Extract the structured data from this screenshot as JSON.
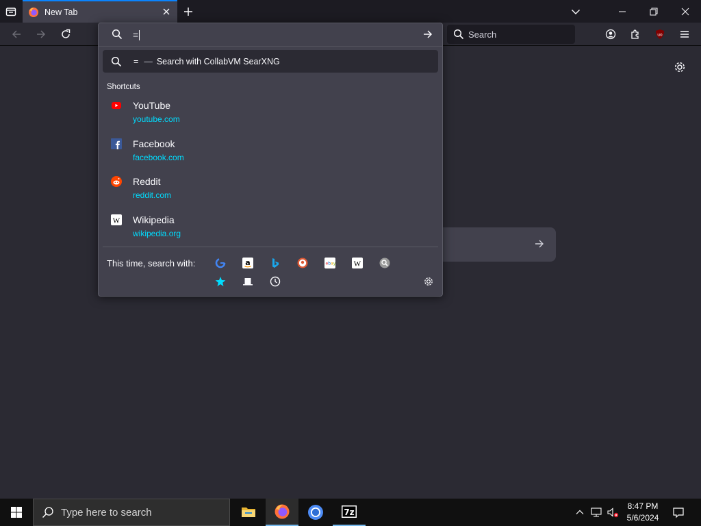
{
  "browser": {
    "tab": {
      "title": "New Tab"
    },
    "search_box": {
      "placeholder": "Search"
    },
    "urlbar": {
      "value": "=",
      "heuristic": {
        "query": "=",
        "separator": "—",
        "action": "Search with CollabVM SearXNG"
      },
      "shortcuts_title": "Shortcuts",
      "shortcuts": [
        {
          "title": "YouTube",
          "url": "youtube.com",
          "icon": "youtube-icon"
        },
        {
          "title": "Facebook",
          "url": "facebook.com",
          "icon": "facebook-icon"
        },
        {
          "title": "Reddit",
          "url": "reddit.com",
          "icon": "reddit-icon"
        },
        {
          "title": "Wikipedia",
          "url": "wikipedia.org",
          "icon": "wikipedia-icon"
        }
      ],
      "oneoff_label": "This time, search with:",
      "oneoff_engines": [
        "google-icon",
        "amazon-icon",
        "bing-icon",
        "duckduckgo-icon",
        "ebay-icon",
        "wikipedia-icon",
        "searxng-icon"
      ],
      "oneoff_modes": [
        "bookmarks-star-icon",
        "tabs-icon",
        "history-clock-icon"
      ]
    }
  },
  "taskbar": {
    "search_placeholder": "Type here to search",
    "clock": {
      "time": "8:47 PM",
      "date": "5/6/2024"
    }
  },
  "colors": {
    "accent": "#0a84ff",
    "link": "#00ddff",
    "toolbar_bg": "#2b2a33",
    "popup_bg": "#42414d"
  }
}
